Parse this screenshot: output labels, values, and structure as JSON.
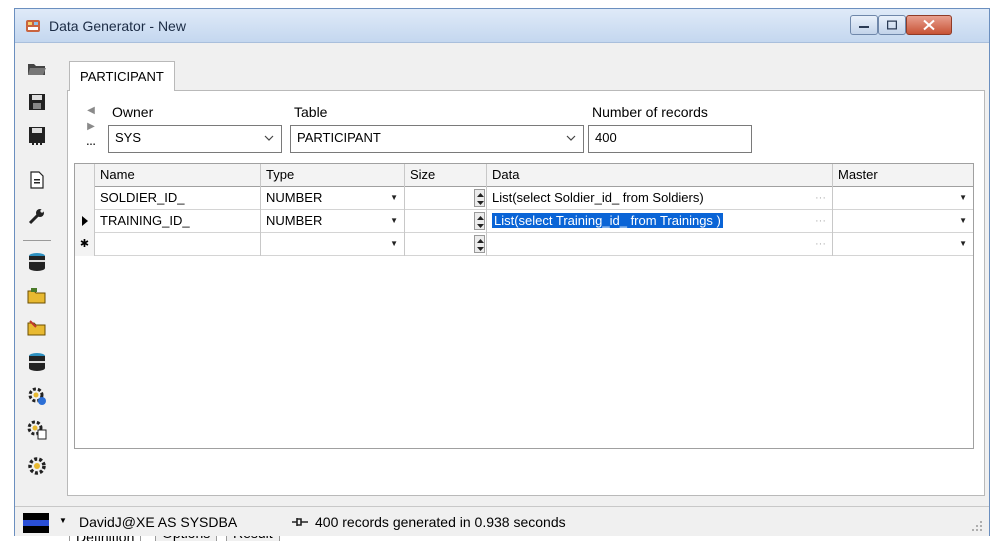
{
  "window": {
    "title": "Data Generator - New"
  },
  "tab": {
    "label": "PARTICIPANT"
  },
  "form": {
    "owner_label": "Owner",
    "owner_value": "SYS",
    "table_label": "Table",
    "table_value": "PARTICIPANT",
    "records_label": "Number of records",
    "records_value": "400"
  },
  "grid": {
    "columns": [
      "Name",
      "Type",
      "Size",
      "Data",
      "Master"
    ],
    "rows": [
      {
        "name": "SOLDIER_ID_",
        "type": "NUMBER",
        "size": "",
        "data": "List(select Soldier_id_ from Soldiers)",
        "master": ""
      },
      {
        "name": "TRAINING_ID_",
        "type": "NUMBER",
        "size": "",
        "data": "List(select Training_id_ from Trainings )",
        "master": ""
      },
      {
        "name": "",
        "type": "",
        "size": "",
        "data": "",
        "master": ""
      }
    ]
  },
  "bottom_tabs": [
    "Definition",
    "Options",
    "Result"
  ],
  "status": {
    "session": "DavidJ@XE AS SYSDBA",
    "message": "400 records generated in 0.938 seconds"
  },
  "icons": [
    "open-folder-icon",
    "save-icon",
    "save-as-icon",
    "document-icon",
    "wrench-icon",
    "database-icon",
    "folder-open-icon",
    "folder-edit-icon",
    "database-icon-2",
    "gear-db-icon",
    "gear-doc-icon",
    "gear-icon"
  ]
}
